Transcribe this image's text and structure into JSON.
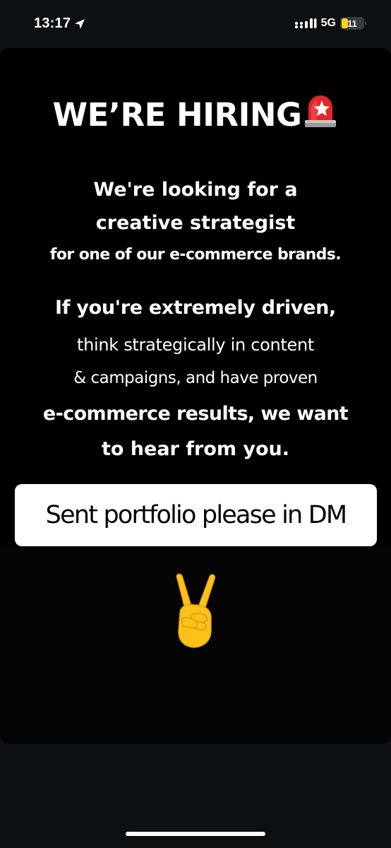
{
  "status_bar": {
    "time": "13:17",
    "network": "5G",
    "battery_level": "11",
    "battery_fraction": 0.11,
    "battery_color": "#ffd60a",
    "icons": [
      "location-arrow-icon",
      "signal-strength-icon",
      "battery-icon"
    ]
  },
  "story": {
    "headline": "WE’RE HIRING",
    "headline_emoji": "siren-icon",
    "paragraph1": [
      "We're looking for a",
      "creative strategist",
      "for one of our e-commerce brands."
    ],
    "paragraph2": [
      "If you're extremely driven,",
      "think strategically in content",
      "& campaigns, and have proven",
      "e-commerce results, we want",
      "to hear from you."
    ],
    "caption": "Sent portfolio please in DM",
    "reaction_emoji": "victory-hand-icon"
  }
}
